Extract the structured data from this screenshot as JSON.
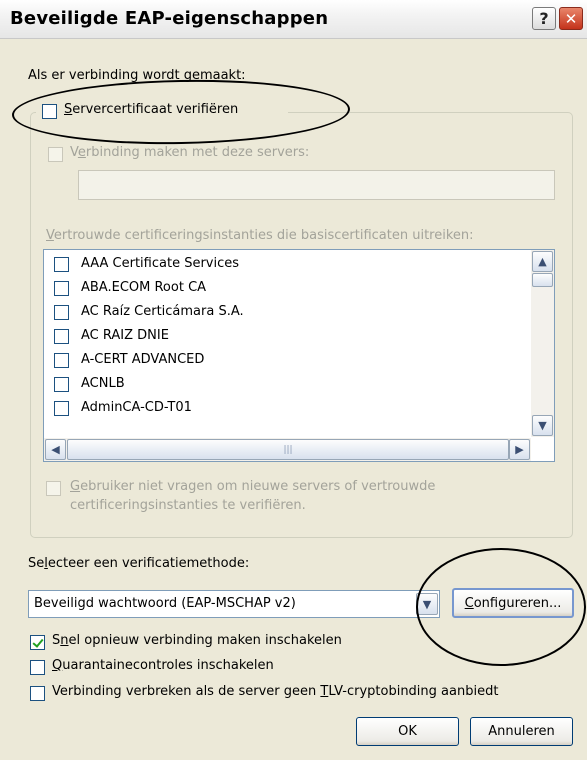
{
  "window": {
    "title": "Beveiligde EAP-eigenschappen",
    "help_label": "?",
    "close_label": "✕"
  },
  "connection_group": {
    "heading": "Als er verbinding wordt gemaakt:",
    "verify_cert_label": "Servercertificaat verifiëren",
    "verify_cert_checked": false,
    "connect_servers_label": "Verbinding maken met deze servers:",
    "connect_servers_checked": false,
    "servers_value": "",
    "trusted_ca_label": "Vertrouwde certificeringsinstanties die basiscertificaten uitreiken:",
    "ca_items": [
      {
        "label": "AAA Certificate Services",
        "checked": false
      },
      {
        "label": "ABA.ECOM Root CA",
        "checked": false
      },
      {
        "label": "AC Raíz Certicámara S.A.",
        "checked": false
      },
      {
        "label": "AC RAIZ DNIE",
        "checked": false
      },
      {
        "label": "A-CERT ADVANCED",
        "checked": false
      },
      {
        "label": "ACNLB",
        "checked": false
      },
      {
        "label": "AdminCA-CD-T01",
        "checked": false
      }
    ],
    "no_prompt_label_line1": "Gebruiker niet vragen om nieuwe servers of vertrouwde",
    "no_prompt_label_line2": "certificeringsinstanties te verifiëren.",
    "no_prompt_checked": false
  },
  "auth": {
    "method_label": "Selecteer een verificatiemethode:",
    "method_value": "Beveiligd wachtwoord (EAP-MSCHAP v2)",
    "configure_label": "Configureren...",
    "fast_reconnect_label": "Snel opnieuw verbinding maken inschakelen",
    "fast_reconnect_checked": true,
    "quarantine_label": "Quarantainecontroles inschakelen",
    "quarantine_checked": false,
    "tlv_label": "Verbinding verbreken als de server geen TLV-cryptobinding aanbiedt",
    "tlv_checked": false
  },
  "buttons": {
    "ok_label": "OK",
    "cancel_label": "Annuleren"
  },
  "icons": {
    "scroll_up": "▲",
    "scroll_down": "▼",
    "scroll_left": "◀",
    "scroll_right": "▶",
    "dropdown": "▼",
    "grip": "|||"
  }
}
